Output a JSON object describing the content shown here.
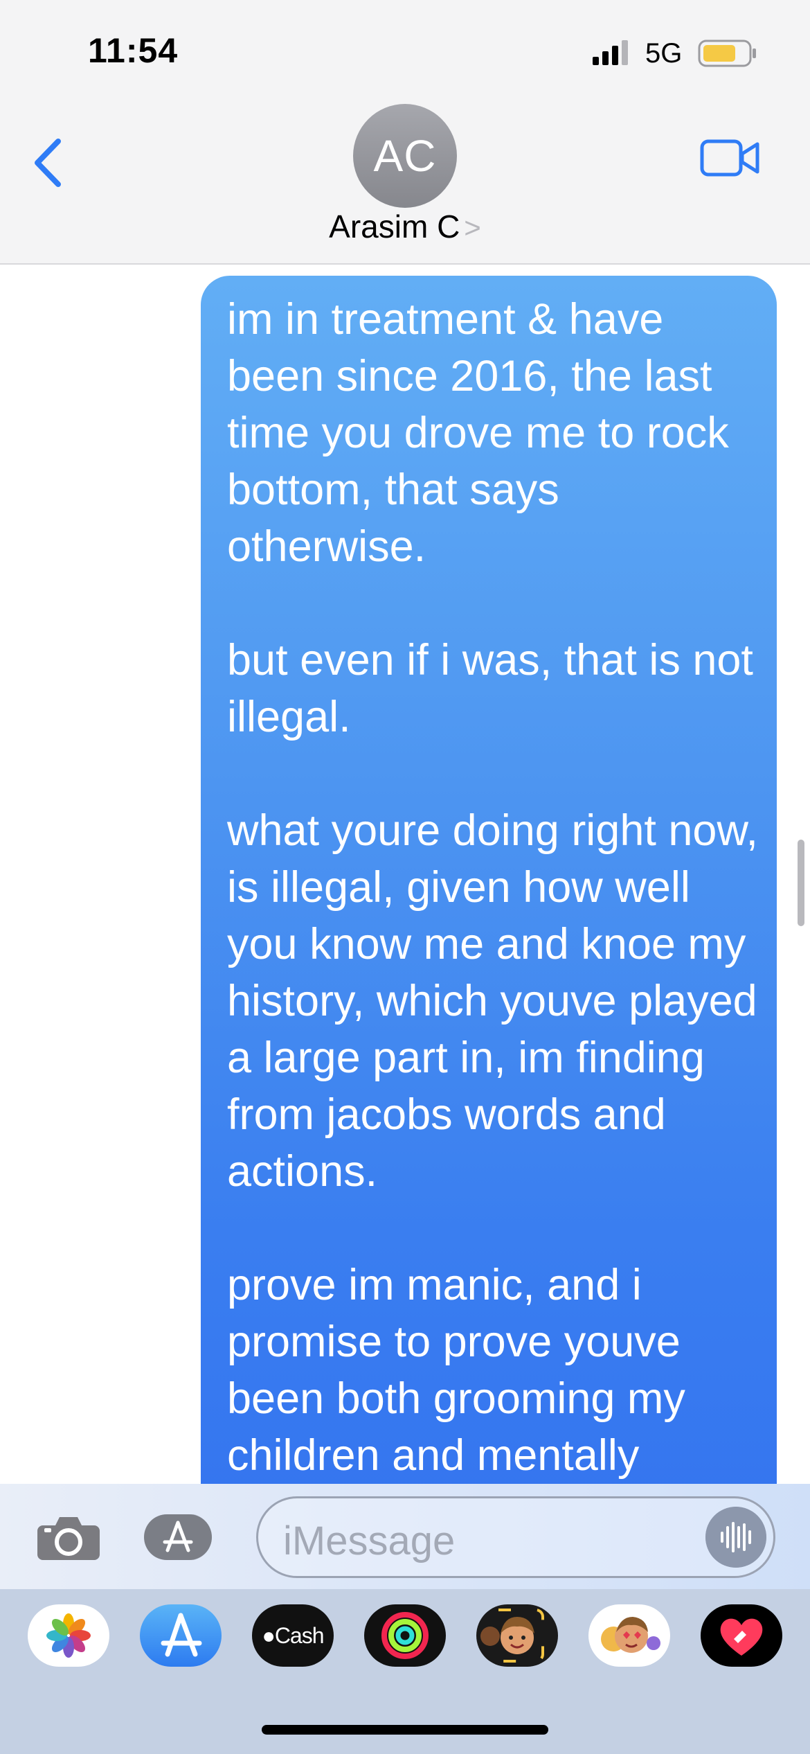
{
  "status_bar": {
    "time": "11:54",
    "network": "5G",
    "signal_icon": "cellular-signal-icon",
    "battery_icon": "battery-icon",
    "battery_color": "#f5c945"
  },
  "header": {
    "back_icon": "chevron-left-icon",
    "avatar_initials": "AC",
    "contact_name": "Arasim C",
    "contact_chevron": ">",
    "video_icon": "video-camera-icon",
    "accent_color": "#2f7cf6"
  },
  "conversation": {
    "messages": [
      {
        "direction": "sent",
        "text": "im in treatment & have been since 2016, the last time you drove me to rock bottom, that says otherwise.\n\nbut even if i was, that is not illegal.\n\nwhat youre doing right now, is illegal, given how well you know me and knoe my history, which youve played a large part in, im finding from jacobs words and actions.\n\nprove im manic, and i promise to prove youve been both grooming my children and mentally"
      }
    ]
  },
  "compose": {
    "camera_icon": "camera-icon",
    "apps_icon": "app-store-icon",
    "placeholder": "iMessage",
    "audio_icon": "audio-waveform-icon"
  },
  "app_drawer": {
    "apps": [
      {
        "name": "photos-app-icon"
      },
      {
        "name": "app-store-app-icon"
      },
      {
        "name": "apple-cash-app-icon",
        "label": "Cash"
      },
      {
        "name": "fitness-app-icon"
      },
      {
        "name": "memoji-app-icon"
      },
      {
        "name": "memoji-stickers-app-icon"
      },
      {
        "name": "digital-touch-app-icon"
      }
    ]
  }
}
